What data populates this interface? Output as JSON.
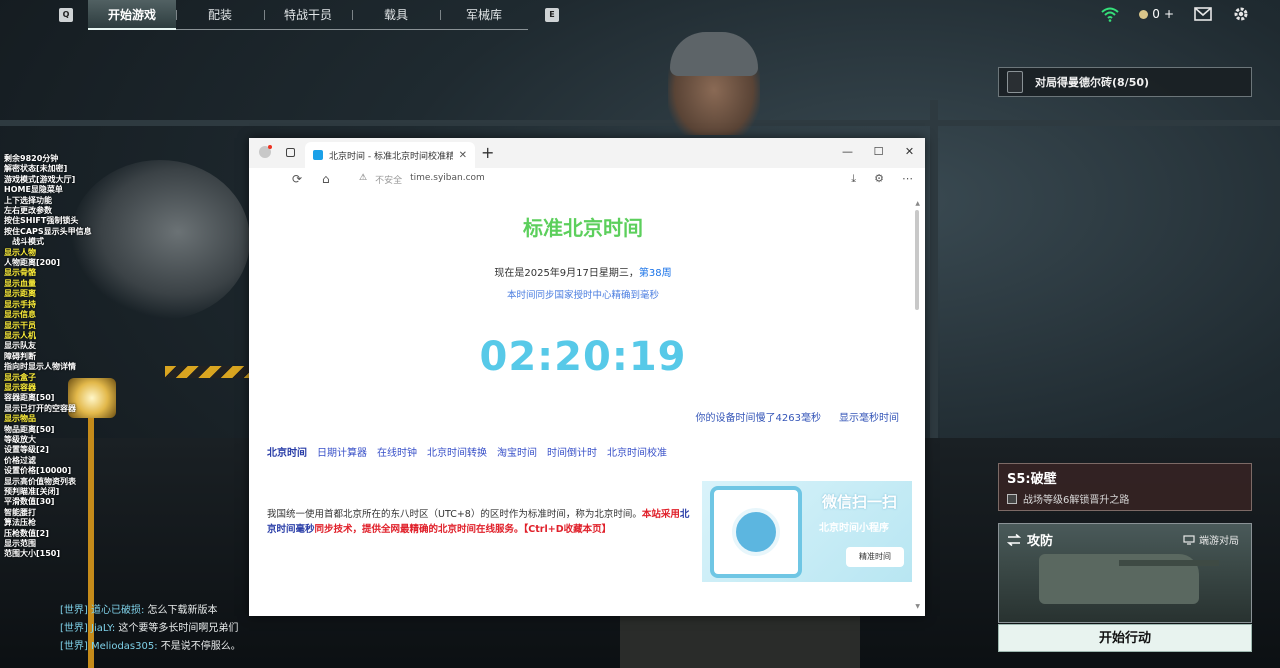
{
  "topbar": {
    "left_key": "Q",
    "right_key": "E",
    "tabs": [
      {
        "label": "开始游戏",
        "active": true
      },
      {
        "label": "配装",
        "active": false
      },
      {
        "label": "特战干员",
        "active": false
      },
      {
        "label": "载具",
        "active": false
      },
      {
        "label": "军械库",
        "active": false
      }
    ],
    "currency": "0",
    "currency_add": "+"
  },
  "overlay_menu": [
    {
      "text": "剩余9820分钟",
      "color": "w"
    },
    {
      "text": "解密状态[未加密]",
      "color": "w"
    },
    {
      "text": "游戏模式[游戏大厅]",
      "color": "w"
    },
    {
      "text": "HOME显隐菜单",
      "color": "w"
    },
    {
      "text": "上下选择功能",
      "color": "w"
    },
    {
      "text": "左右更改参数",
      "color": "w"
    },
    {
      "text": "按住SHIFT强制锁头",
      "color": "w"
    },
    {
      "text": "按住CAPS显示头甲信息",
      "color": "w"
    },
    {
      "text": "战斗模式",
      "color": "w",
      "indent": true
    },
    {
      "text": "显示人物",
      "color": "y"
    },
    {
      "text": "人物距离[200]",
      "color": "w"
    },
    {
      "text": "显示骨骼",
      "color": "y"
    },
    {
      "text": "显示血量",
      "color": "y"
    },
    {
      "text": "显示距离",
      "color": "y"
    },
    {
      "text": "显示手持",
      "color": "y"
    },
    {
      "text": "显示信息",
      "color": "y"
    },
    {
      "text": "显示干员",
      "color": "y"
    },
    {
      "text": "显示人机",
      "color": "y"
    },
    {
      "text": "显示队友",
      "color": "w"
    },
    {
      "text": "障碍判断",
      "color": "w"
    },
    {
      "text": "指向时显示人物详情",
      "color": "w"
    },
    {
      "text": "显示盒子",
      "color": "y"
    },
    {
      "text": "显示容器",
      "color": "y"
    },
    {
      "text": "容器距离[50]",
      "color": "w"
    },
    {
      "text": "显示已打开的空容器",
      "color": "w"
    },
    {
      "text": "显示物品",
      "color": "y"
    },
    {
      "text": "物品距离[50]",
      "color": "w"
    },
    {
      "text": "等级放大",
      "color": "w"
    },
    {
      "text": "设置等级[2]",
      "color": "w"
    },
    {
      "text": "价格过滤",
      "color": "w"
    },
    {
      "text": "设置价格[10000]",
      "color": "w"
    },
    {
      "text": "显示高价值物资列表",
      "color": "w"
    },
    {
      "text": "预判瞄准[关闭]",
      "color": "w"
    },
    {
      "text": "平滑数值[30]",
      "color": "w"
    },
    {
      "text": "智能腰打",
      "color": "w"
    },
    {
      "text": "算法压枪",
      "color": "w"
    },
    {
      "text": "压枪数值[2]",
      "color": "w"
    },
    {
      "text": "显示范围",
      "color": "w"
    },
    {
      "text": "范围大小[150]",
      "color": "w"
    }
  ],
  "chat": [
    {
      "channel": "[世界]",
      "name": "道心已破损",
      "text": "怎么下载新版本"
    },
    {
      "channel": "[世界]",
      "name": "JiaLY",
      "text": "这个要等多长时间啊兄弟们"
    },
    {
      "channel": "[世界]",
      "name": "Meliodas305",
      "text": "不是说不停服么。"
    }
  ],
  "mission": {
    "text": "对局得曼德尔砖(8/50)"
  },
  "season": {
    "title": "S5:破壁",
    "sub": "战场等级6解锁晋升之路"
  },
  "mode": {
    "label": "攻防",
    "side_label": "端游对局",
    "start_label": "开始行动"
  },
  "browser": {
    "tab_title": "北京时间 - 标准北京时间校准精确",
    "win_min": "—",
    "win_max": "☐",
    "win_close": "✕",
    "url_insecure": "不安全",
    "url_host": "time.syiban.com",
    "page": {
      "title": "标准北京时间",
      "date_prefix": "现在是2025年9月17日星期三，",
      "week": "第38周",
      "sync_note": "本时间同步国家授时中心精确到毫秒",
      "clock": "02:20:19",
      "diff_prefix": "你的设备时间慢了",
      "diff_value": "4263",
      "diff_unit": "毫秒",
      "show_ms": "显示毫秒时间",
      "links": [
        {
          "label": "北京时间",
          "current": true
        },
        {
          "label": "日期计算器",
          "current": false
        },
        {
          "label": "在线时钟",
          "current": false
        },
        {
          "label": "北京时间转换",
          "current": false
        },
        {
          "label": "淘宝时间",
          "current": false
        },
        {
          "label": "时间倒计时",
          "current": false
        },
        {
          "label": "北京时间校准",
          "current": false
        }
      ],
      "desc_plain": "我国统一使用首都北京所在的东八时区（UTC+8）的区时作为标准时间，称为北京时间。",
      "desc_red1": "本站采用",
      "desc_blue": "北京时间毫秒",
      "desc_red2": "同步技术，提供全网最精确的北京时间在线服务。",
      "desc_red3": "【Ctrl+D收藏本页】",
      "qr_scan": "微信扫一扫",
      "qr_mini": "北京时间小程序",
      "qr_btn": "精准时间"
    }
  }
}
